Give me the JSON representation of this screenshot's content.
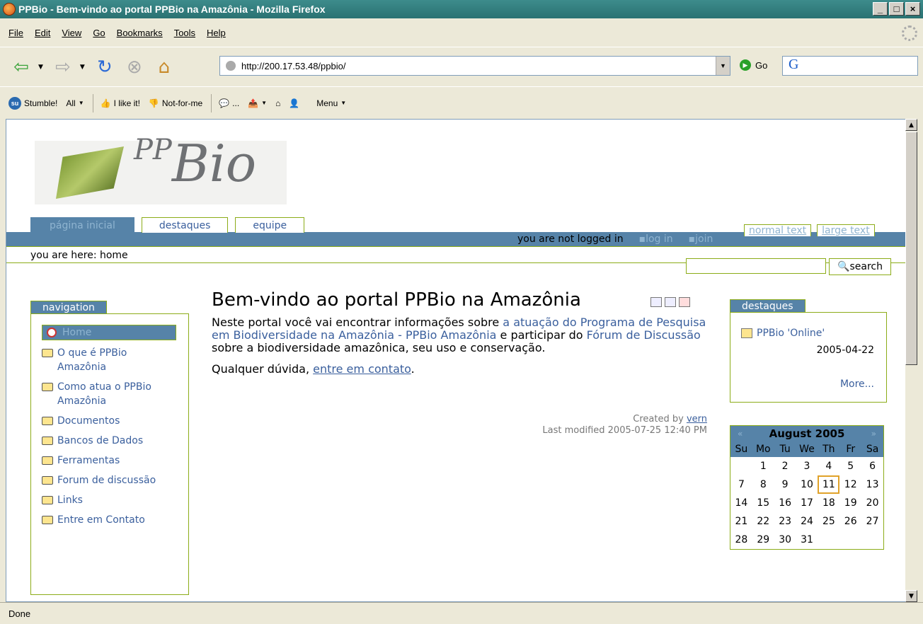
{
  "window": {
    "title": "PPBio - Bem-vindo ao portal PPBio na Amazônia - Mozilla Firefox"
  },
  "menubar": [
    "File",
    "Edit",
    "View",
    "Go",
    "Bookmarks",
    "Tools",
    "Help"
  ],
  "toolbar": {
    "url": "http://200.17.53.48/ppbio/",
    "go_label": "Go",
    "google_label": "G"
  },
  "stumblebar": {
    "stumble": "Stumble!",
    "all": "All",
    "like": "I like it!",
    "notforme": "Not-for-me",
    "dots": "...",
    "menu": "Menu"
  },
  "site": {
    "logo_pp": "PP",
    "logo_bio": "Bio",
    "tabs": [
      "página inicial",
      "destaques",
      "equipe"
    ],
    "text_size": [
      "normal text",
      "large text"
    ],
    "user_status": "you are not logged in",
    "login": "log in",
    "join": "join",
    "breadcrumb": "you are here: home",
    "search_button": "search"
  },
  "navigation": {
    "title": "navigation",
    "items": [
      "Home",
      "O que é PPBio Amazônia",
      "Como atua o PPBio Amazônia",
      "Documentos",
      "Bancos de Dados",
      "Ferramentas",
      "Forum de discussão",
      "Links",
      "Entre em Contato"
    ]
  },
  "main": {
    "title": "Bem-vindo ao portal PPBio na Amazônia",
    "p1_a": "Neste portal você vai encontrar informações sobre ",
    "p1_link1": "a atuação do Programa de Pesquisa em Biodiversidade na Amazônia - PPBio Amazônia",
    "p1_b": " e participar do ",
    "p1_link2": "Fórum de Discussão",
    "p1_c": " sobre a biodiversidade amazônica, seu uso e conservação.",
    "p2_a": "Qualquer dúvida, ",
    "p2_link": "entre em contato",
    "p2_b": ".",
    "created_by": "Created by ",
    "author": "vern",
    "modified": "Last modified 2005-07-25 12:40 PM"
  },
  "destaques": {
    "title": "destaques",
    "item": "PPBio 'Online'",
    "date": "2005-04-22",
    "more": "More..."
  },
  "calendar": {
    "prev": "«",
    "month": "August 2005",
    "next": "»",
    "weekdays": [
      "Su",
      "Mo",
      "Tu",
      "We",
      "Th",
      "Fr",
      "Sa"
    ],
    "days": [
      "",
      "1",
      "2",
      "3",
      "4",
      "5",
      "6",
      "7",
      "8",
      "9",
      "10",
      "11",
      "12",
      "13",
      "14",
      "15",
      "16",
      "17",
      "18",
      "19",
      "20",
      "21",
      "22",
      "23",
      "24",
      "25",
      "26",
      "27",
      "28",
      "29",
      "30",
      "31",
      "",
      "",
      ""
    ],
    "today": "11"
  },
  "status": "Done"
}
